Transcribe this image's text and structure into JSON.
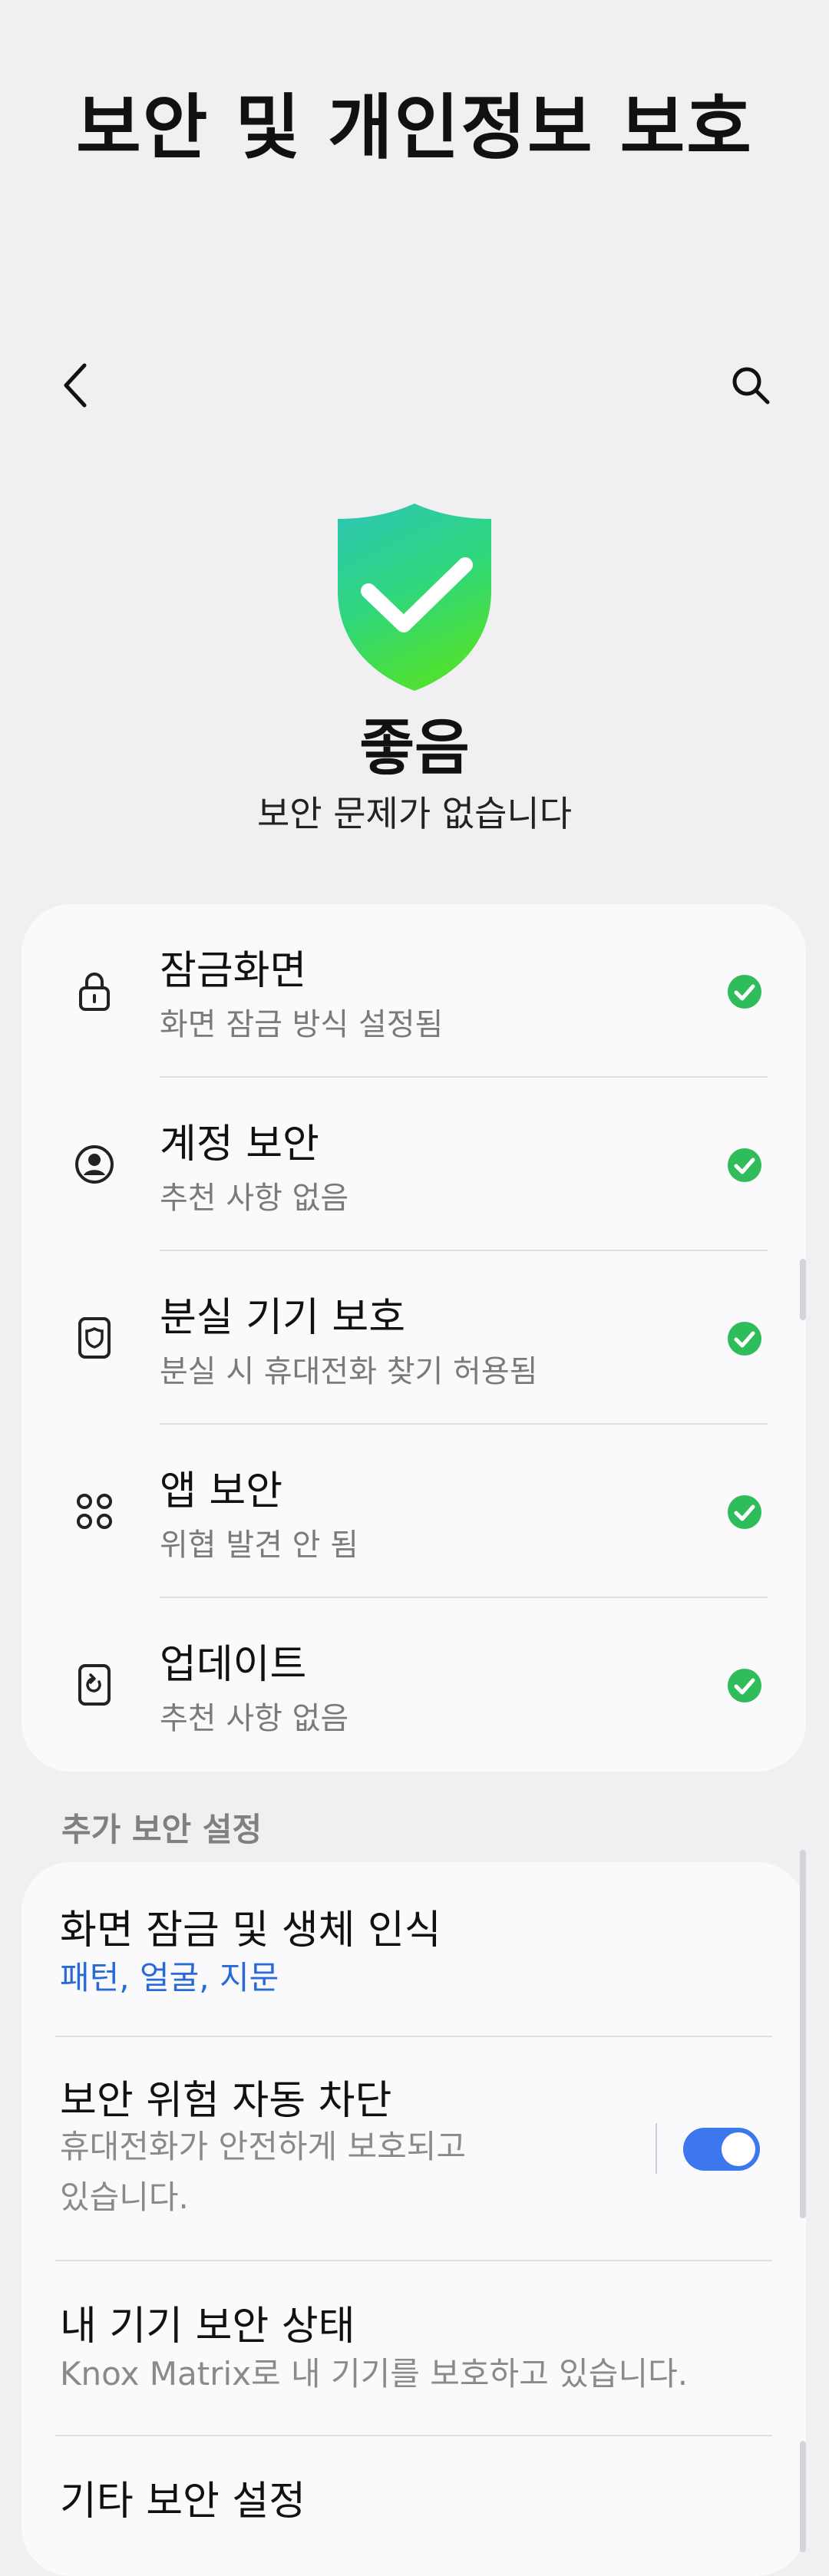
{
  "header": {
    "title": "보안 및 개인정보 보호",
    "back_icon": "chevron-left-icon",
    "search_icon": "search-icon"
  },
  "status": {
    "icon": "shield-check-icon",
    "title": "좋음",
    "subtitle": "보안 문제가 없습니다",
    "colors": {
      "shield_top": "#2ec9b0",
      "shield_bottom": "#3ee04a",
      "check": "#2ebd5a"
    }
  },
  "checks": [
    {
      "icon": "lock-icon",
      "title": "잠금화면",
      "subtitle": "화면 잠금 방식 설정됨",
      "status": "ok"
    },
    {
      "icon": "account-icon",
      "title": "계정 보안",
      "subtitle": "추천 사항 없음",
      "status": "ok"
    },
    {
      "icon": "lost-device-icon",
      "title": "분실 기기 보호",
      "subtitle": "분실 시 휴대전화 찾기 허용됨",
      "status": "ok"
    },
    {
      "icon": "apps-icon",
      "title": "앱 보안",
      "subtitle": "위협 발견 안 됨",
      "status": "ok"
    },
    {
      "icon": "update-icon",
      "title": "업데이트",
      "subtitle": "추천 사항 없음",
      "status": "ok"
    }
  ],
  "additional": {
    "header": "추가 보안 설정",
    "items": [
      {
        "title": "화면 잠금 및 생체 인식",
        "subtitle": "패턴, 얼굴, 지문"
      },
      {
        "title": "보안 위험 자동 차단",
        "subtitle_line1": "휴대전화가 안전하게 보호되고",
        "subtitle_line2": "있습니다.",
        "toggle": true
      },
      {
        "title": "내 기기 보안 상태",
        "subtitle": "Knox Matrix로 내 기기를 보호하고 있습니다."
      },
      {
        "title": "기타 보안 설정"
      }
    ],
    "accent_color": "#3c77f0"
  }
}
